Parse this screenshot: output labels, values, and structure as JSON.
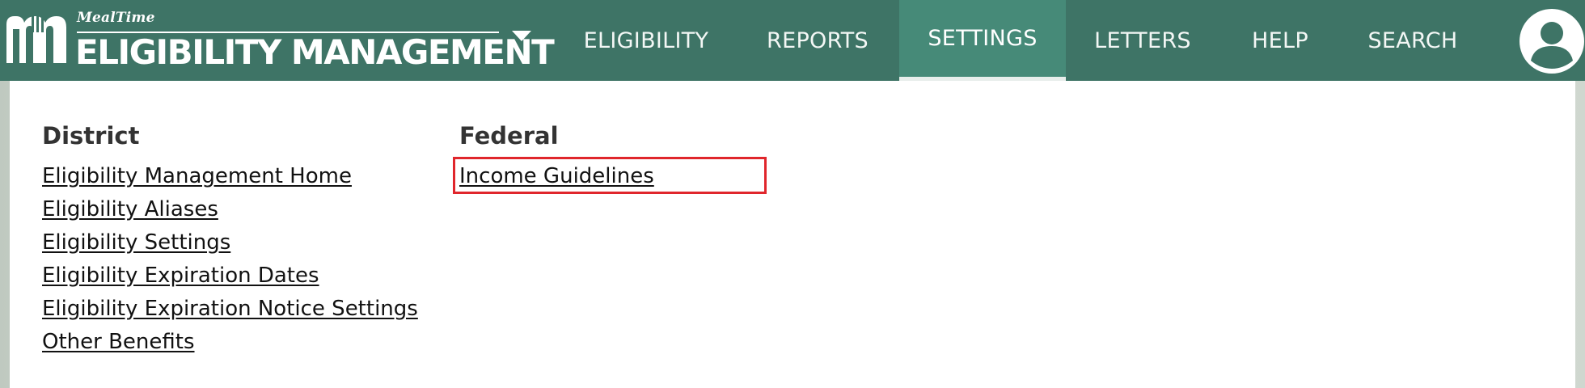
{
  "header": {
    "brand_small": "MealTime",
    "brand_title": "ELIGIBILITY MANAGEMENT",
    "nav": [
      {
        "label": "ELIGIBILITY",
        "active": false
      },
      {
        "label": "REPORTS",
        "active": false
      },
      {
        "label": "SETTINGS",
        "active": true
      },
      {
        "label": "LETTERS",
        "active": false
      },
      {
        "label": "HELP",
        "active": false
      },
      {
        "label": "SEARCH",
        "active": false
      }
    ],
    "colors": {
      "bar": "#3e7466",
      "active_tab": "#468a78"
    }
  },
  "menu": {
    "district": {
      "title": "District",
      "links": [
        "Eligibility Management Home",
        "Eligibility Aliases",
        "Eligibility Settings",
        "Eligibility Expiration Dates",
        "Eligibility Expiration Notice Settings",
        "Other Benefits"
      ]
    },
    "federal": {
      "title": "Federal",
      "links": [
        "Income Guidelines"
      ],
      "highlighted_link": "Income Guidelines",
      "highlight_color": "#e0262c"
    }
  },
  "icons": {
    "logo": "mealtime-m-fork-logo",
    "brand_menu": "caret-down-icon",
    "user": "user-avatar-icon"
  }
}
